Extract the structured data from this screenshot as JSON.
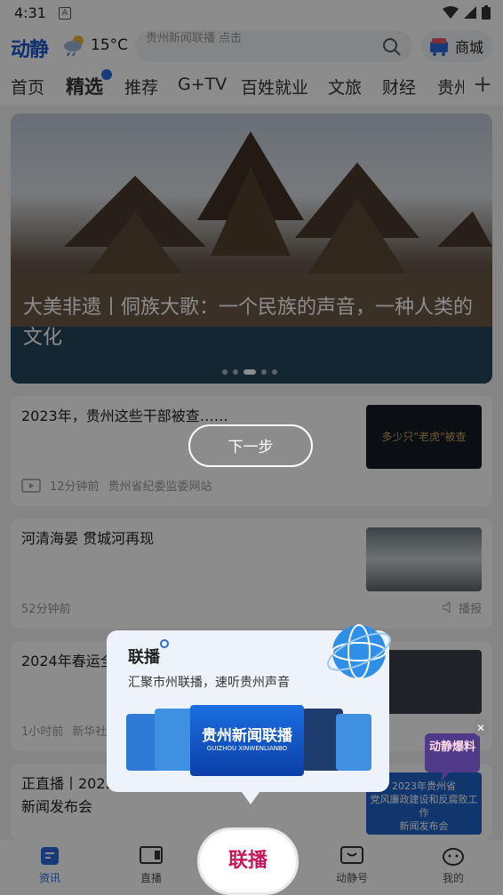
{
  "status": {
    "time": "4:31",
    "a_badge": "A"
  },
  "header": {
    "logo": "动静",
    "temperature": "15°C",
    "search_placeholder": "贵州新闻联播 点击",
    "mall_label": "商城"
  },
  "tabs": [
    "首页",
    "精选",
    "推荐",
    "G+TV",
    "百姓就业",
    "文旅",
    "财经",
    "贵州"
  ],
  "active_tab_index": 1,
  "banner": {
    "caption": "大美非遗丨侗族大歌：一个民族的声音，一种人类的文化",
    "slide_count": 5,
    "active_slide": 2
  },
  "news": [
    {
      "title": "2023年，贵州这些干部被查……",
      "time": "12分钟前",
      "source": "贵州省纪委监委网站",
      "has_video": true,
      "thumb_text": "多少只\"老虎\"被查"
    },
    {
      "title": "河清海晏 贯城河再现",
      "time": "52分钟前",
      "source": "",
      "broadcast": "播报"
    },
    {
      "title": "2024年春运全",
      "time": "1小时前",
      "source": "新华社"
    },
    {
      "title": "正直播丨2023\n新闻发布会",
      "time": "",
      "source": "",
      "thumb_text": "2023年贵州省\n党风廉政建设和反腐败工作\n新闻发布会"
    }
  ],
  "guide": {
    "next_label": "下一步",
    "popup_title": "联播",
    "popup_subtitle": "汇聚市州联播，速听贵州声音",
    "popup_image_text": "贵州新闻联播",
    "popup_image_sub": "GUIZHOU XINWENLIANBO"
  },
  "baoliao": "动静爆料",
  "bottom_nav": {
    "items": [
      "资讯",
      "直播",
      "动静号",
      "我的"
    ],
    "center": "联播"
  },
  "colors": {
    "brand_blue": "#1d56c7",
    "accent_blue": "#2a6bdc",
    "center_magenta": "#c41a5b"
  }
}
